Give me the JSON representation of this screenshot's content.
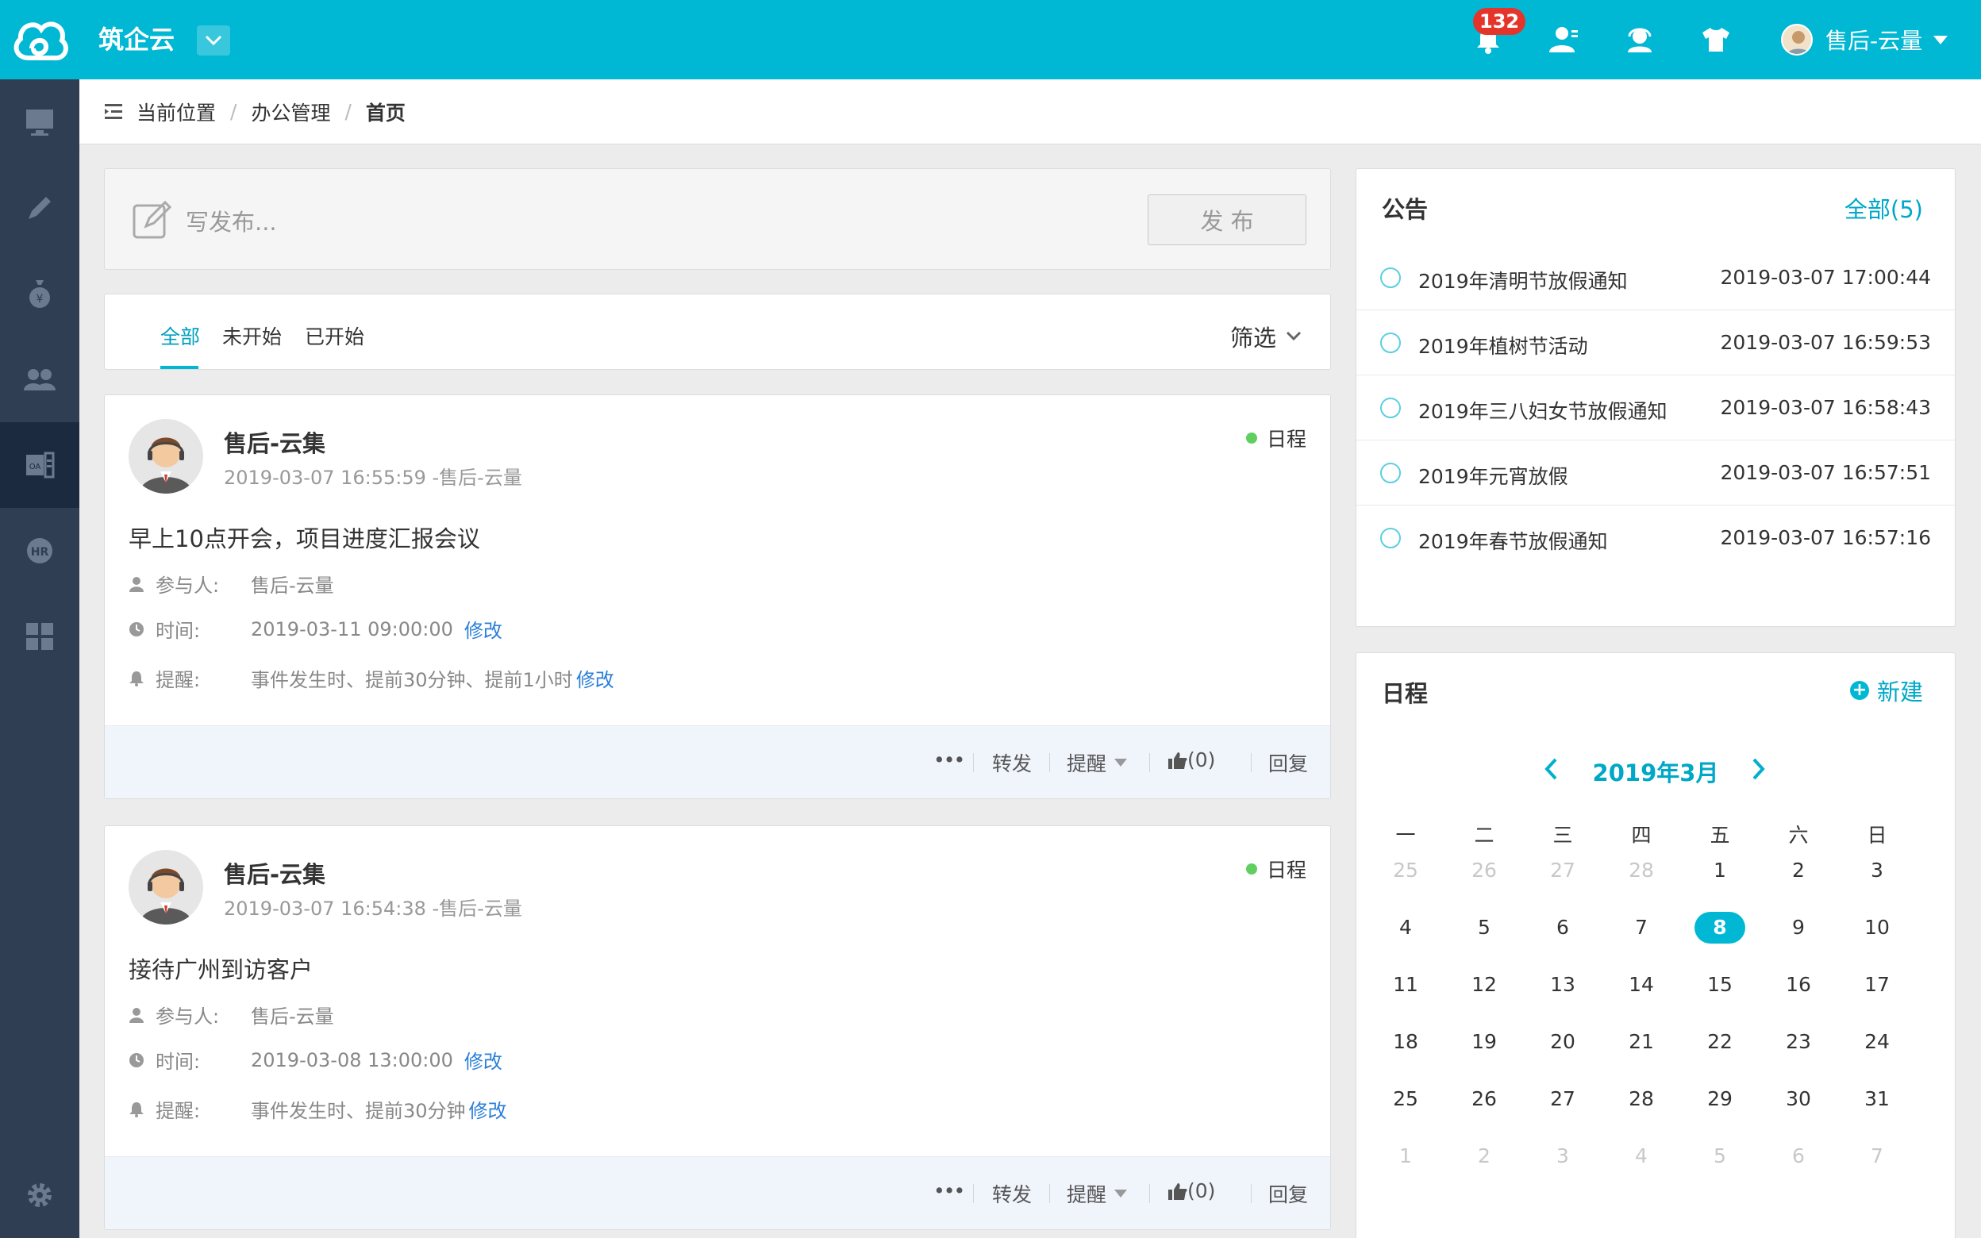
{
  "header": {
    "brand": "筑企云",
    "notification_count": "132",
    "user_name": "售后-云量"
  },
  "breadcrumb": {
    "label": "当前位置",
    "section": "办公管理",
    "current": "首页"
  },
  "composer": {
    "placeholder": "写发布...",
    "publish_label": "发 布"
  },
  "tabs": {
    "items": [
      "全部",
      "未开始",
      "已开始"
    ],
    "filter_label": "筛选"
  },
  "posts": [
    {
      "author": "售后-云集",
      "meta": "2019-03-07 16:55:59 -售后-云量",
      "tag": "日程",
      "title": "早上10点开会，项目进度汇报会议",
      "participants_label": "参与人:",
      "participants": "售后-云量",
      "time_label": "时间:",
      "time": "2019-03-11 09:00:00",
      "edit_time": "修改",
      "remind_label": "提醒:",
      "remind": "事件发生时、提前30分钟、提前1小时",
      "edit_remind": "修改",
      "footer": {
        "more": "•••",
        "forward": "转发",
        "remind": "提醒",
        "like": "(0)",
        "reply": "回复"
      }
    },
    {
      "author": "售后-云集",
      "meta": "2019-03-07 16:54:38 -售后-云量",
      "tag": "日程",
      "title": "接待广州到访客户",
      "participants_label": "参与人:",
      "participants": "售后-云量",
      "time_label": "时间:",
      "time": "2019-03-08 13:00:00",
      "edit_time": "修改",
      "remind_label": "提醒:",
      "remind": "事件发生时、提前30分钟",
      "edit_remind": "修改",
      "footer": {
        "more": "•••",
        "forward": "转发",
        "remind": "提醒",
        "like": "(0)",
        "reply": "回复"
      }
    }
  ],
  "notice": {
    "title": "公告",
    "all_link": "全部(5)",
    "items": [
      {
        "title": "2019年清明节放假通知",
        "time": "2019-03-07 17:00:44"
      },
      {
        "title": "2019年植树节活动",
        "time": "2019-03-07 16:59:53"
      },
      {
        "title": "2019年三八妇女节放假通知",
        "time": "2019-03-07 16:58:43"
      },
      {
        "title": "2019年元宵放假",
        "time": "2019-03-07 16:57:51"
      },
      {
        "title": "2019年春节放假通知",
        "time": "2019-03-07 16:57:16"
      }
    ]
  },
  "calendar": {
    "title": "日程",
    "new_label": "新建",
    "month": "2019年3月",
    "weekdays": [
      "一",
      "二",
      "三",
      "四",
      "五",
      "六",
      "日"
    ],
    "weeks": [
      [
        "25",
        "26",
        "27",
        "28",
        "1",
        "2",
        "3"
      ],
      [
        "4",
        "5",
        "6",
        "7",
        "8",
        "9",
        "10"
      ],
      [
        "11",
        "12",
        "13",
        "14",
        "15",
        "16",
        "17"
      ],
      [
        "18",
        "19",
        "20",
        "21",
        "22",
        "23",
        "24"
      ],
      [
        "25",
        "26",
        "27",
        "28",
        "29",
        "30",
        "31"
      ],
      [
        "1",
        "2",
        "3",
        "4",
        "5",
        "6",
        "7"
      ]
    ],
    "today": "8"
  },
  "colors": {
    "primary": "#00b8d4",
    "sidebar": "#2f3e52",
    "badge": "#e5352b",
    "link": "#2b7fd8"
  }
}
